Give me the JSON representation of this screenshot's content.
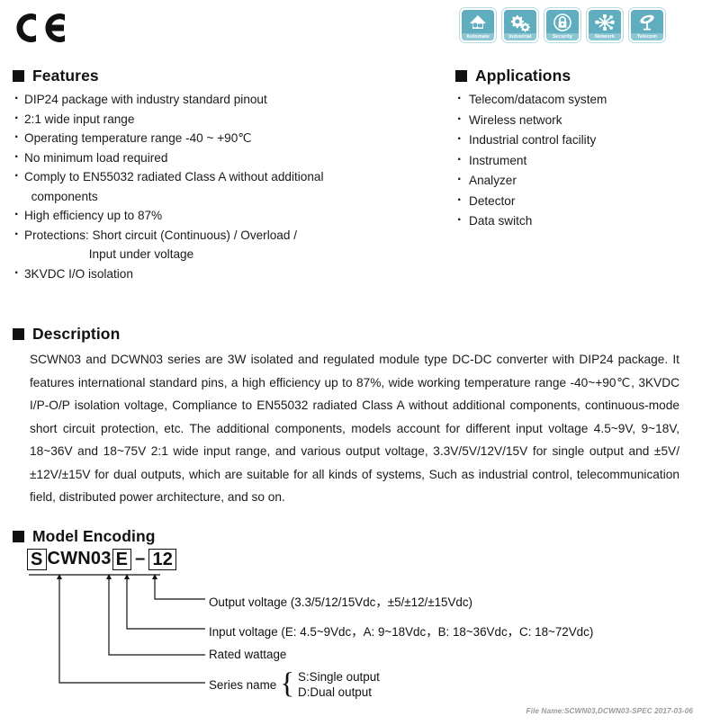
{
  "certification": {
    "mark": "CE",
    "icon": "ce-mark-icon"
  },
  "app_icons": [
    {
      "id": "automate-icon",
      "label": "Automate"
    },
    {
      "id": "industrial-icon",
      "label": "Industrial"
    },
    {
      "id": "security-icon",
      "label": "Security"
    },
    {
      "id": "network-icon",
      "label": "Network"
    },
    {
      "id": "telecom-icon",
      "label": "Telecom"
    }
  ],
  "features": {
    "title": "Features",
    "items": [
      {
        "text": "DIP24 package with industry standard pinout",
        "cont": false
      },
      {
        "text": "2:1 wide input range",
        "cont": false
      },
      {
        "text": "Operating temperature range -40 ~ +90℃",
        "cont": false
      },
      {
        "text": "No minimum load required",
        "cont": false
      },
      {
        "text": "Comply to EN55032 radiated Class A without additional",
        "cont": false
      },
      {
        "text": "  components",
        "cont": true
      },
      {
        "text": "High efficiency up to 87%",
        "cont": false
      },
      {
        "text": "Protections: Short circuit (Continuous) / Overload /",
        "cont": false
      },
      {
        "text": "                   Input under voltage",
        "cont": true
      },
      {
        "text": "3KVDC I/O isolation",
        "cont": false
      }
    ]
  },
  "applications": {
    "title": "Applications",
    "items": [
      {
        "text": "Telecom/datacom system",
        "cont": false
      },
      {
        "text": "Wireless network",
        "cont": false
      },
      {
        "text": "Industrial control facility",
        "cont": false
      },
      {
        "text": "Instrument",
        "cont": false
      },
      {
        "text": "Analyzer",
        "cont": false
      },
      {
        "text": "Detector",
        "cont": false
      },
      {
        "text": "Data switch",
        "cont": false
      }
    ]
  },
  "description": {
    "title": "Description",
    "body": "SCWN03 and DCWN03 series are 3W isolated and regulated module type DC-DC converter with DIP24 package. It features international standard pins, a high efficiency up to 87%, wide working temperature range -40~+90℃, 3KVDC I/P-O/P isolation voltage, Compliance to EN55032 radiated Class A without additional  components, continuous-mode short circuit protection, etc. The additional components,  models account for different input voltage 4.5~9V, 9~18V, 18~36V and 18~75V 2:1 wide input range, and various output voltage, 3.3V/5V/12V/15V  for single output and ±5V/±12V/±15V for dual outputs, which are suitable for all kinds of systems, Such  as industrial control, telecommunication field, distributed power architecture, and so on."
  },
  "model_encoding": {
    "title": "Model Encoding",
    "code": {
      "series": "S",
      "family": "CWN03",
      "input": "E",
      "dash": "–",
      "output": "12"
    },
    "labels": {
      "output_voltage": "Output voltage (3.3/5/12/15Vdc，±5/±12/±15Vdc)",
      "input_voltage": "Input voltage (E: 4.5~9Vdc，A: 9~18Vdc，B: 18~36Vdc，C: 18~72Vdc)",
      "rated_wattage": "Rated wattage",
      "series_name": "Series name",
      "series_single": "S:Single output",
      "series_dual": "D:Dual output"
    }
  },
  "footer": {
    "note": "File Name:SCWN03,DCWN03-SPEC   2017-03-06"
  },
  "colors": {
    "icon_bg": "#5fadbe",
    "icon_label_bg": "#8cc6d3",
    "text": "#1a1a1a",
    "footer_text": "#9a9a9a"
  }
}
